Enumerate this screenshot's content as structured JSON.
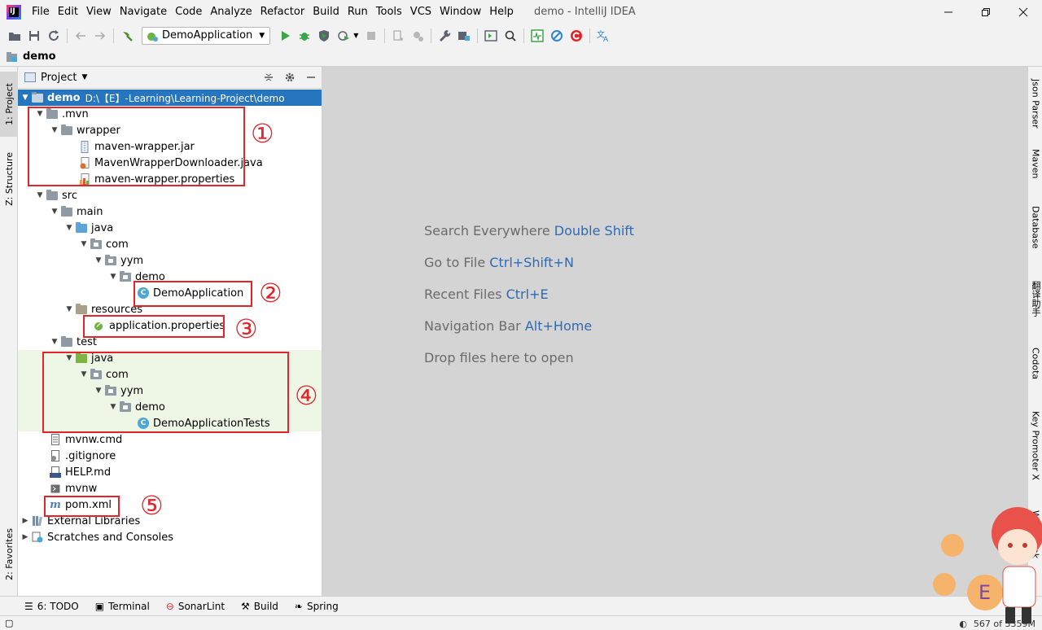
{
  "app": {
    "logo_text": "IJ",
    "window_title": "demo - IntelliJ IDEA"
  },
  "menu": [
    "File",
    "Edit",
    "View",
    "Navigate",
    "Code",
    "Analyze",
    "Refactor",
    "Build",
    "Run",
    "Tools",
    "VCS",
    "Window",
    "Help"
  ],
  "toolbar": {
    "run_config": "DemoApplication"
  },
  "navbar": {
    "project": "demo"
  },
  "left_stripe": {
    "project_tab": "1: Project",
    "structure_tab": "Z: Structure",
    "favorites_tab": "2: Favorites"
  },
  "right_stripe": {
    "json_parser": "Json Parser",
    "maven": "Maven",
    "database": "Database",
    "translate": "翻译助手",
    "codota": "Codota",
    "key_promoter": "Key Promoter X",
    "word_book": "Word Book"
  },
  "project_panel": {
    "title": "Project",
    "root_name": "demo",
    "root_path": "D:\\【E】-Learning\\Learning-Project\\demo",
    "tree": [
      {
        "label": ".mvn"
      },
      {
        "label": "wrapper"
      },
      {
        "label": "maven-wrapper.jar"
      },
      {
        "label": "MavenWrapperDownloader.java"
      },
      {
        "label": "maven-wrapper.properties"
      },
      {
        "label": "src"
      },
      {
        "label": "main"
      },
      {
        "label": "java"
      },
      {
        "label": "com"
      },
      {
        "label": "yym"
      },
      {
        "label": "demo"
      },
      {
        "label": "DemoApplication"
      },
      {
        "label": "resources"
      },
      {
        "label": "application.properties"
      },
      {
        "label": "test"
      },
      {
        "label": "java"
      },
      {
        "label": "com"
      },
      {
        "label": "yym"
      },
      {
        "label": "demo"
      },
      {
        "label": "DemoApplicationTests"
      },
      {
        "label": "mvnw.cmd"
      },
      {
        "label": ".gitignore"
      },
      {
        "label": "HELP.md"
      },
      {
        "label": "mvnw"
      },
      {
        "label": "pom.xml"
      },
      {
        "label": "External Libraries"
      },
      {
        "label": "Scratches and Consoles"
      }
    ],
    "annotations": [
      "①",
      "②",
      "③",
      "④",
      "⑤"
    ]
  },
  "editor_hints": [
    {
      "text": "Search Everywhere",
      "key": "Double Shift"
    },
    {
      "text": "Go to File",
      "key": "Ctrl+Shift+N"
    },
    {
      "text": "Recent Files",
      "key": "Ctrl+E"
    },
    {
      "text": "Navigation Bar",
      "key": "Alt+Home"
    },
    {
      "text": "Drop files here to open",
      "key": ""
    }
  ],
  "bottom_tabs": [
    {
      "label": "6: TODO",
      "icon": "list-icon"
    },
    {
      "label": "Terminal",
      "icon": "terminal-icon"
    },
    {
      "label": "SonarLint",
      "icon": "sonarlint-icon"
    },
    {
      "label": "Build",
      "icon": "hammer-icon"
    },
    {
      "label": "Spring",
      "icon": "spring-leaf-icon"
    }
  ],
  "status": {
    "memory": "567 of 3359M"
  },
  "colors": {
    "selection": "#2675bf",
    "annotation": "#e3242b",
    "hint_key": "#2d6ab5",
    "test_background": "#eef7e6"
  }
}
